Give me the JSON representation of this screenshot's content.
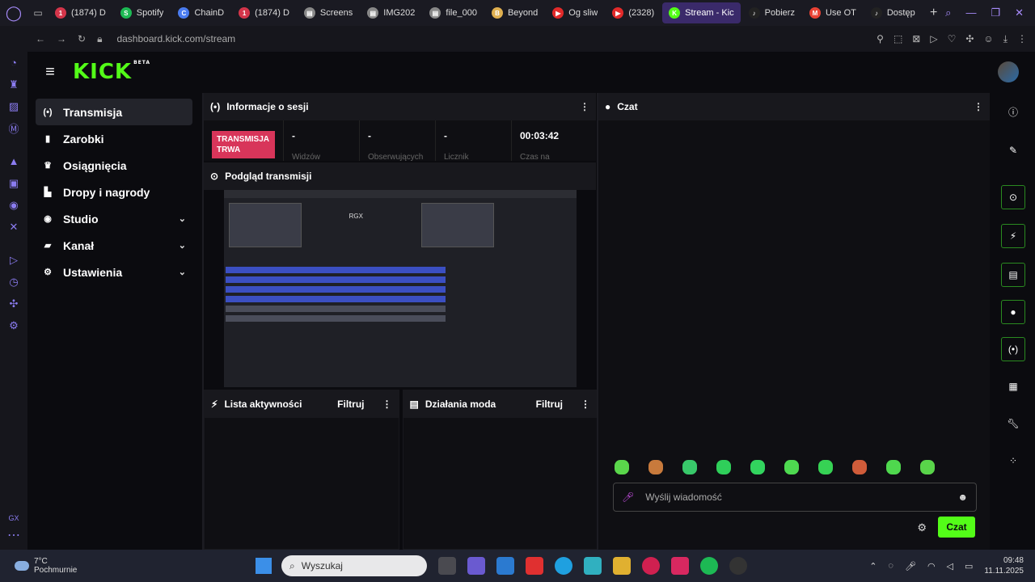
{
  "browser": {
    "tabs": [
      {
        "label": "(1874) D",
        "color": "#d4354a",
        "glyph": "1"
      },
      {
        "label": "Spotify",
        "color": "#1db954",
        "glyph": "S"
      },
      {
        "label": "ChainD",
        "color": "#4a7cf0",
        "glyph": "C"
      },
      {
        "label": "(1874) D",
        "color": "#d4354a",
        "glyph": "1"
      },
      {
        "label": "Screens",
        "color": "#888888",
        "glyph": "▤"
      },
      {
        "label": "IMG202",
        "color": "#888888",
        "glyph": "▤"
      },
      {
        "label": "file_000",
        "color": "#888888",
        "glyph": "▤"
      },
      {
        "label": "Beyond",
        "color": "#e0b050",
        "glyph": "B"
      },
      {
        "label": "Og sliw",
        "color": "#e22a2a",
        "glyph": "▶"
      },
      {
        "label": "(2328) ",
        "color": "#e22a2a",
        "glyph": "▶"
      },
      {
        "label": "Stream - Kic",
        "color": "#53fc18",
        "glyph": "K",
        "active": true
      },
      {
        "label": "Pobierz",
        "color": "#222222",
        "glyph": "♪"
      },
      {
        "label": "Use OT",
        "color": "#ea4335",
        "glyph": "M"
      },
      {
        "label": "Dostęp",
        "color": "#222222",
        "glyph": "♪"
      }
    ],
    "url": "dashboard.kick.com/stream"
  },
  "header": {
    "logo": "KICK",
    "beta": "BETA"
  },
  "nav": [
    {
      "label": "Transmisja",
      "icon": "broadcast-icon",
      "glyph": "(•)",
      "active": true
    },
    {
      "label": "Zarobki",
      "icon": "earnings-icon",
      "glyph": "▮"
    },
    {
      "label": "Osiągnięcia",
      "icon": "trophy-icon",
      "glyph": "♛"
    },
    {
      "label": "Dropy i nagrody",
      "icon": "drops-icon",
      "glyph": "▙"
    },
    {
      "label": "Studio",
      "icon": "studio-icon",
      "glyph": "◉",
      "chevron": true
    },
    {
      "label": "Kanał",
      "icon": "channel-icon",
      "glyph": "▰",
      "chevron": true
    },
    {
      "label": "Ustawienia",
      "icon": "settings-icon",
      "glyph": "⚙",
      "chevron": true
    }
  ],
  "session": {
    "title": "Informacje o sesji",
    "badge": "TRANSMISJA TRWA",
    "stats": [
      {
        "value": "-",
        "label": "Widzów"
      },
      {
        "value": "-",
        "label": "Obserwujących"
      },
      {
        "value": "-",
        "label": "Licznik"
      },
      {
        "value": "00:03:42",
        "label": "Czas na"
      }
    ]
  },
  "preview": {
    "title": "Podgląd transmisji",
    "rgx": "RGX"
  },
  "activity": {
    "title": "Lista aktywności",
    "filter": "Filtruj"
  },
  "modactions": {
    "title": "Działania moda",
    "filter": "Filtruj"
  },
  "chat": {
    "title": "Czat",
    "placeholder": "Wyślij wiadomość",
    "send": "Czat",
    "emote_colors": [
      "#5ad64b",
      "#c87a3c",
      "#38c86a",
      "#2fcf5a",
      "#32d45e",
      "#4ed950",
      "#36d254",
      "#d05c3a",
      "#4fd84e",
      "#59d44a"
    ]
  },
  "rightrail": [
    "info-icon",
    "pencil-icon",
    "camera-icon",
    "bolt-icon",
    "notes-icon",
    "chat-icon",
    "broadcast-icon",
    "layout-icon",
    "wrench-icon",
    "apps-icon"
  ],
  "taskbar": {
    "temp": "7°C",
    "weather": "Pochmurnie",
    "search_placeholder": "Wyszukaj",
    "time": "09:48",
    "date": "11.11.2025"
  }
}
